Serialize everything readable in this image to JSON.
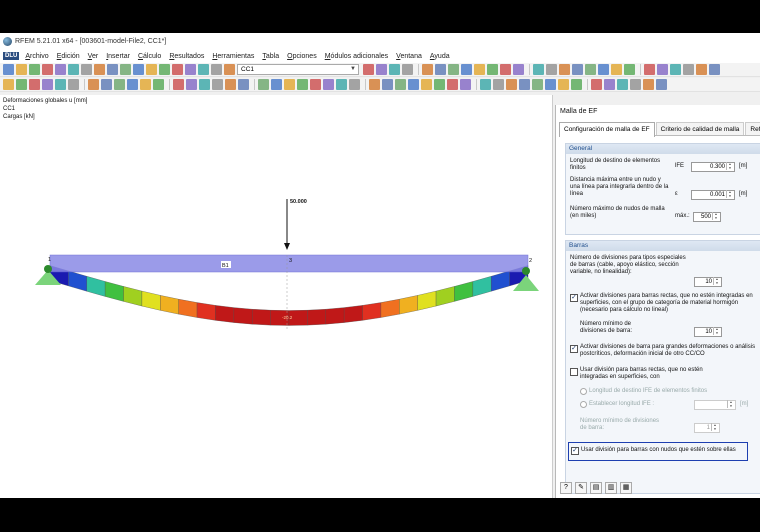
{
  "window": {
    "title": "RFEM 5.21.01 x64 - [003601-model-File2, CC1*]"
  },
  "menu": {
    "logo": "DLU",
    "items": [
      "Archivo",
      "Edición",
      "Ver",
      "Insertar",
      "Cálculo",
      "Resultados",
      "Herramientas",
      "Tabla",
      "Opciones",
      "Módulos adicionales",
      "Ventana",
      "Ayuda"
    ]
  },
  "toolbar": {
    "load_case": "CC1"
  },
  "canvas": {
    "info_lines": [
      "Deformaciones globales u [mm]",
      "CC1",
      "Cargas [kN]"
    ],
    "load_value": "50.000",
    "member_label": "B1",
    "node_labels": [
      "1",
      "2",
      "3"
    ],
    "max_label": "-20.2"
  },
  "panel": {
    "title": "Malla de EF",
    "tabs": [
      "Configuración de malla de EF",
      "Criterio de calidad de malla",
      "Refinam"
    ],
    "general": {
      "header": "General",
      "target_length_label": "Longitud de destino de elementos finitos",
      "target_length_symbol": "lFE",
      "target_length_value": "0.300",
      "target_length_unit": "[m]",
      "max_distance_label": "Distancia máxima entre un nudo y una línea para integrarla dentro de la línea",
      "max_distance_symbol": "ε",
      "max_distance_value": "0.001",
      "max_distance_unit": "[m]",
      "max_nodes_label": "Número máximo de nudos de malla (en miles)",
      "max_nodes_symbol": "máx.:",
      "max_nodes_value": "500"
    },
    "barras": {
      "header": "Barras",
      "special_divisions_label": "Número de divisiones para tipos especiales de barras (cable, apoyo elástico, sección variable, no linealidad):",
      "special_divisions_value": "10",
      "activate_straight_label": "Activar divisiones para barras rectas, que no estén integradas en superficies, con el grupo de categoría de material hormigón (necesario para cálculo no lineal)",
      "min_divisions_label": "Número mínimo de divisiones de barra:",
      "min_divisions_value": "10",
      "large_def_label": "Activar divisiones de barra para grandes deformaciones o análisis postcríticos, deformación inicial de otro CC/CO",
      "use_division_label": "Usar división para barras rectas, que no estén integradas en superficies, con",
      "fe_length_label": "Longitud de destino lFE de elementos finitos",
      "set_length_label": "Establecer longitud lFE :",
      "set_length_unit": "[m]",
      "min_div2_label": "Número mínimo de divisiones de barra:",
      "min_div2_value": "1",
      "nodes_on_bars_label": "Usar división para barras con nudos que estén sobre ellas"
    }
  },
  "colors": {
    "accent": "#1e3fb0",
    "beam": "#8a8ae6"
  }
}
